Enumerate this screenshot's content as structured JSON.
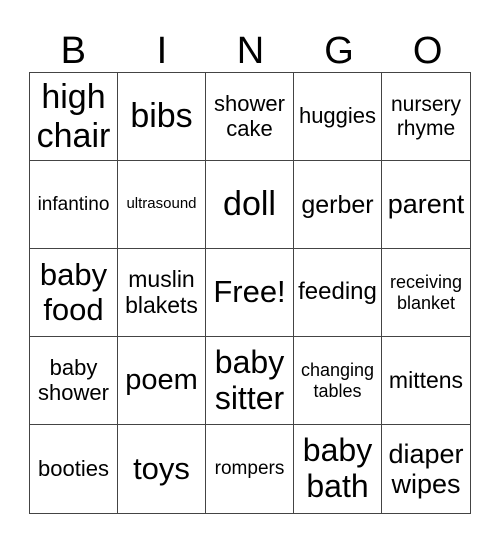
{
  "header": [
    "B",
    "I",
    "N",
    "G",
    "O"
  ],
  "cells": [
    "high\nchair",
    "bibs",
    "shower\ncake",
    "huggies",
    "nursery\nrhyme",
    "infantino",
    "ultrasound",
    "doll",
    "gerber",
    "parent",
    "baby\nfood",
    "muslin\nblakets",
    "Free!",
    "feeding",
    "receiving\nblanket",
    "baby\nshower",
    "poem",
    "baby\nsitter",
    "changing\ntables",
    "mittens",
    "booties",
    "toys",
    "rompers",
    "baby\nbath",
    "diaper\nwipes"
  ]
}
